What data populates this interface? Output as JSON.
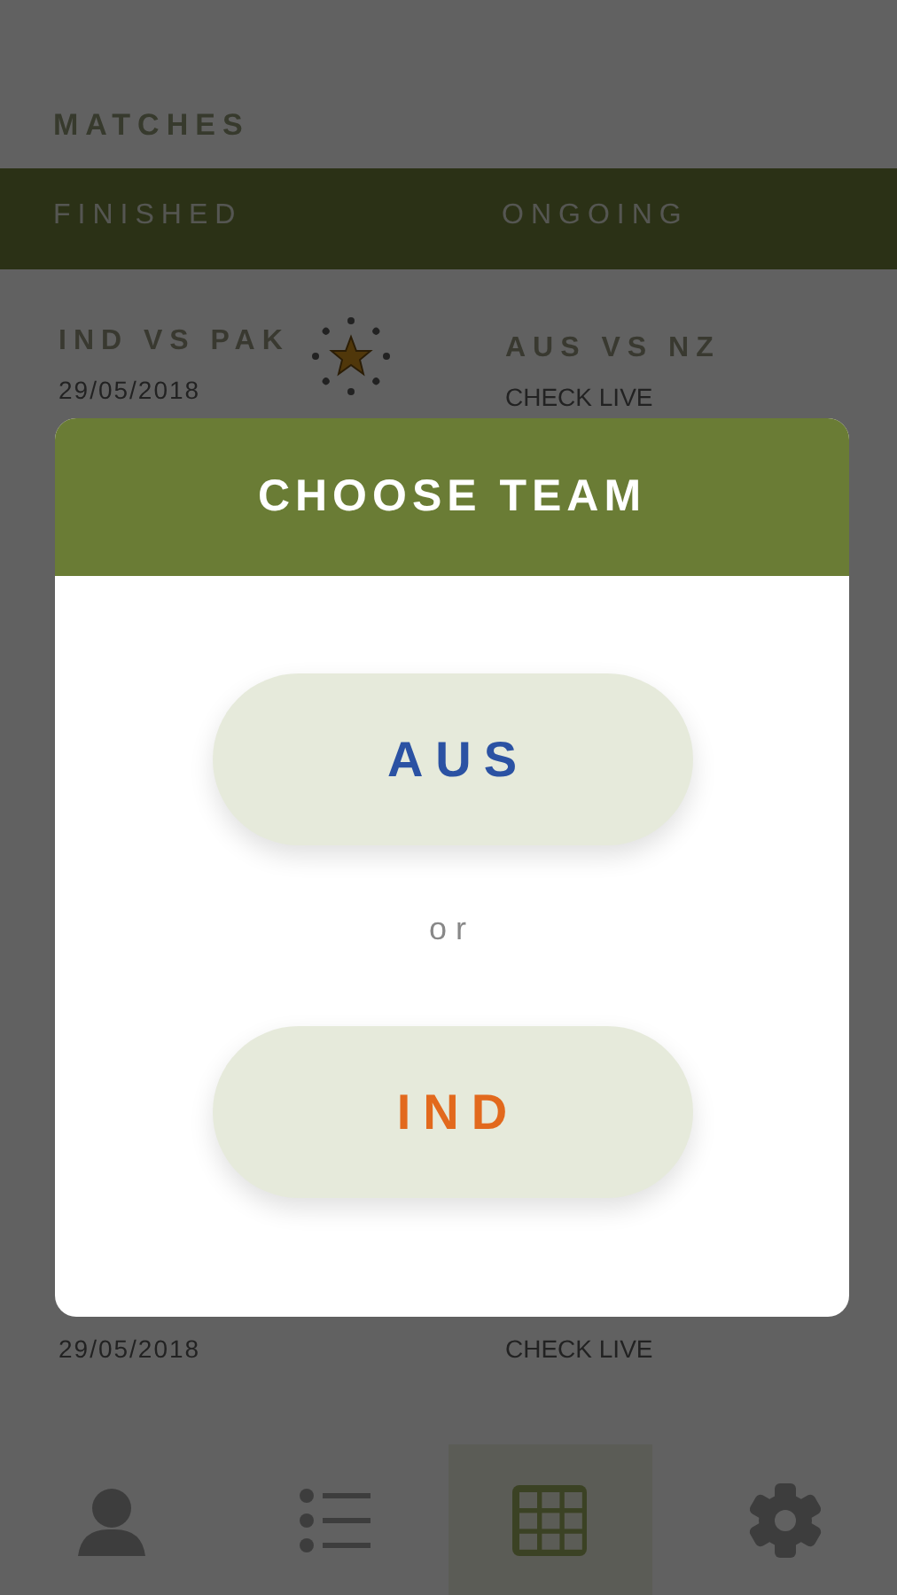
{
  "header": {
    "title": "MATCHES"
  },
  "tabs": [
    {
      "label": "FINISHED",
      "selected": false
    },
    {
      "label": "ONGOING",
      "selected": false
    }
  ],
  "rows": [
    {
      "finished": {
        "title": "IND VS PAK",
        "date": "29/05/2018",
        "starred": true
      },
      "ongoing": {
        "title": "AUS VS NZ",
        "status": "CHECK LIVE"
      }
    },
    {
      "finished": {
        "date": "29/05/2018"
      },
      "ongoing": {
        "status": "CHECK LIVE"
      }
    }
  ],
  "dialog": {
    "title": "CHOOSE TEAM",
    "options": [
      {
        "label": "AUS",
        "color": "#2b52a3"
      },
      {
        "label": "IND",
        "color": "#e2691d"
      }
    ],
    "separator": "or"
  },
  "nav": [
    {
      "kind": "profile",
      "selected": false
    },
    {
      "kind": "list",
      "selected": false
    },
    {
      "kind": "grid",
      "selected": true
    },
    {
      "kind": "settings",
      "selected": false
    }
  ]
}
